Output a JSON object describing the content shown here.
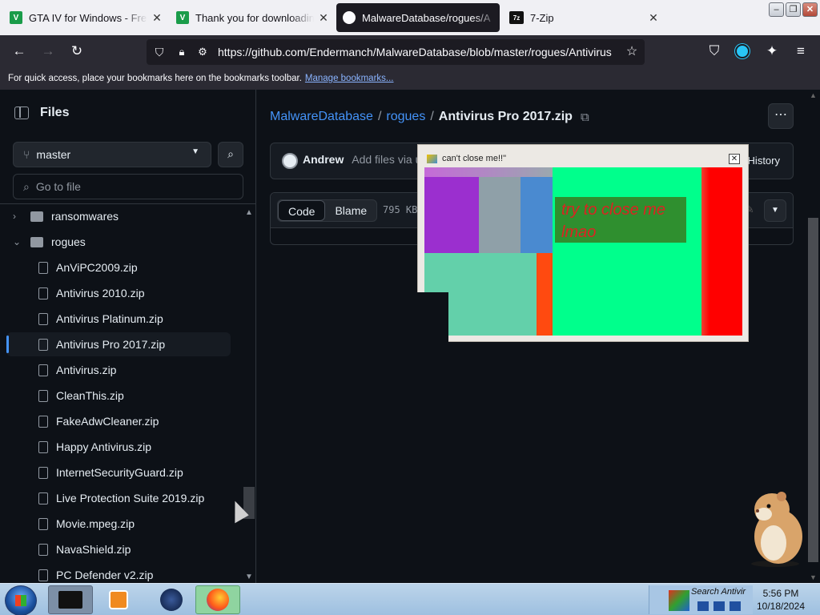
{
  "tabs": [
    {
      "title": "GTA IV for Windows - Free d",
      "favicon": "V",
      "favicon_color": "#1a9c4a",
      "active": false
    },
    {
      "title": "Thank you for downloading",
      "favicon": "V",
      "favicon_color": "#1a9c4a",
      "active": false
    },
    {
      "title": "MalwareDatabase/rogues/A",
      "favicon": "github",
      "favicon_color": "#fbfbfe",
      "active": true
    },
    {
      "title": "7-Zip",
      "favicon": "7z",
      "favicon_color": "#111111",
      "active": false
    }
  ],
  "navbar": {
    "url": "https://github.com/Endermanch/MalwareDatabase/blob/master/rogues/Antivirus"
  },
  "bookmarks": {
    "text": "For quick access, place your bookmarks here on the bookmarks toolbar.",
    "link": "Manage bookmarks..."
  },
  "sidebar": {
    "title": "Files",
    "branch": "master",
    "goto_placeholder": "Go to file",
    "items": [
      {
        "label": "ransomwares",
        "type": "folder",
        "expanded": false
      },
      {
        "label": "rogues",
        "type": "folder",
        "expanded": true
      },
      {
        "label": "AnViPC2009.zip",
        "type": "file"
      },
      {
        "label": "Antivirus 2010.zip",
        "type": "file"
      },
      {
        "label": "Antivirus Platinum.zip",
        "type": "file"
      },
      {
        "label": "Antivirus Pro 2017.zip",
        "type": "file",
        "selected": true
      },
      {
        "label": "Antivirus.zip",
        "type": "file"
      },
      {
        "label": "CleanThis.zip",
        "type": "file"
      },
      {
        "label": "FakeAdwCleaner.zip",
        "type": "file"
      },
      {
        "label": "Happy Antivirus.zip",
        "type": "file"
      },
      {
        "label": "InternetSecurityGuard.zip",
        "type": "file"
      },
      {
        "label": "Live Protection Suite 2019.zip",
        "type": "file"
      },
      {
        "label": "Movie.mpeg.zip",
        "type": "file"
      },
      {
        "label": "NavaShield.zip",
        "type": "file"
      },
      {
        "label": "PC Defender v2.zip",
        "type": "file"
      }
    ]
  },
  "main": {
    "breadcrumb": [
      "MalwareDatabase",
      "rogues"
    ],
    "filename": "Antivirus Pro 2017.zip",
    "commit_author": "Andrew",
    "commit_msg": "Add files via u",
    "history": "History",
    "code_tab": "Code",
    "blame_tab": "Blame",
    "filesize": "795 KB"
  },
  "popup": {
    "title": "can't close me!!\"",
    "message": "try to close me lmao"
  },
  "taskbar": {
    "search": "Search Antivir",
    "time": "5:56 PM",
    "date": "10/18/2024"
  }
}
